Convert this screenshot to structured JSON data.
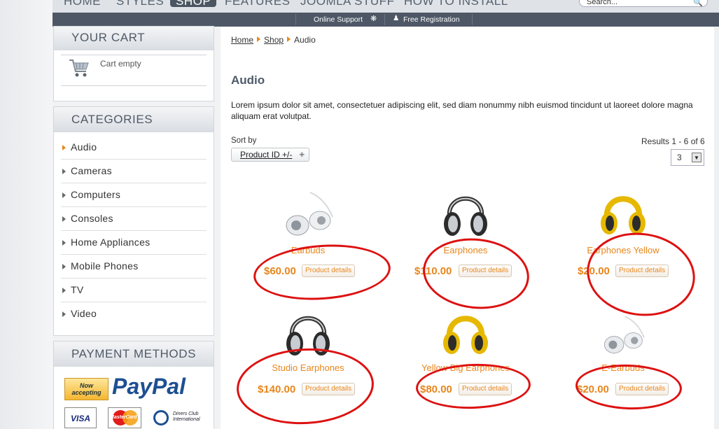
{
  "nav": {
    "items": [
      "HOME",
      "STYLES",
      "SHOP",
      "FEATURES",
      "JOOMLA STUFF",
      "HOW TO INSTALL"
    ],
    "active": "SHOP",
    "search_placeholder": "Search..."
  },
  "subbar": {
    "support": "Online Support",
    "registration": "Free Registration"
  },
  "cart": {
    "title": "YOUR CART",
    "status": "Cart empty"
  },
  "categories": {
    "title": "CATEGORIES",
    "items": [
      "Audio",
      "Cameras",
      "Computers",
      "Consoles",
      "Home Appliances",
      "Mobile Phones",
      "TV",
      "Video"
    ],
    "active": "Audio"
  },
  "payment": {
    "title": "PAYMENT METHODS",
    "paypal_badge": "Now accepting",
    "paypal": "PayPal",
    "cards": [
      "VISA",
      "MasterCard",
      "Diners Club International"
    ]
  },
  "breadcrumb": [
    "Home",
    "Shop",
    "Audio"
  ],
  "page": {
    "title": "Audio",
    "description": "Lorem ipsum dolor sit amet, consectetuer adipiscing elit, sed diam nonummy nibh euismod tincidunt ut laoreet dolore magna aliquam erat volutpat."
  },
  "sort": {
    "label": "Sort by",
    "selected": "Product ID +/-"
  },
  "results": {
    "text": "Results 1 - 6 of 6",
    "per_page": "3"
  },
  "products": [
    {
      "name": "Earbuds",
      "price": "$60.00",
      "button": "Product details",
      "image": "white-earbuds"
    },
    {
      "name": "Earphones",
      "price": "$110.00",
      "button": "Product details",
      "image": "silver-headphones"
    },
    {
      "name": "Earphones Yellow",
      "price": "$20.00",
      "button": "Product details",
      "image": "yellow-headphones"
    },
    {
      "name": "Studio Earphones",
      "price": "$140.00",
      "button": "Product details",
      "image": "silver-headphones"
    },
    {
      "name": "Yellow Big Earphones",
      "price": "$80.00",
      "button": "Product details",
      "image": "yellow-headphones"
    },
    {
      "name": "E-Earbuds",
      "price": "$20.00",
      "button": "Product details",
      "image": "white-earbuds"
    }
  ],
  "colors": {
    "accent": "#e8861c",
    "annotation": "#dd1111",
    "nav_dark": "#4d5766"
  }
}
